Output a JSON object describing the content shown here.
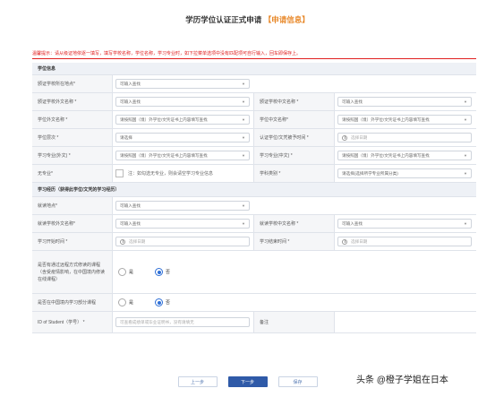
{
  "header": {
    "title": "学历学位认证正式申请",
    "tag": "【申请信息】"
  },
  "warning": "温馨提示：请从级证地依逐一填写，填写学校名称，学位名称，学习专业时，如下拉菜单选项中没有匹配项可自行输入，回车即保存上。",
  "sections": {
    "degree": "学位信息",
    "study": "学习经历（获得此学位/文凭的学习经历）"
  },
  "labels": {
    "issue_country": "颁证学校所在地点*",
    "school_en": "颁证学校外文名称 *",
    "school_cn": "颁证学校中文名称 *",
    "degree_en": "学位外文名称 *",
    "degree_cn": "学位中文名称*",
    "degree_level": "学位层次 *",
    "cert_date": "认证学位/文凭被予时间 *",
    "major_en": "学习专业(外文) *",
    "major_cn": "学习专业(中文) *",
    "no_major": "无专业*",
    "subject": "学科类别 *",
    "study_country": "就读地点*",
    "study_school_en": "就读学校外文名称*",
    "study_school_cn": "就读学校中文名称 *",
    "start": "学习开始时间 *",
    "end": "学习结束时间 *",
    "distance_q": "是否有通过远程方式修读的课程（含受疫情影响，在中国境内修读在线课程）",
    "china_q": "是否在中国境内学习部分课程",
    "student_id": "ID of Student（学号） *",
    "remark": "备注"
  },
  "fields": {
    "issue_country": "可输入查找",
    "school_en": "可输入查找",
    "school_cn": "可输入查找",
    "degree_en": "请按照国（境）外学位/文凭证书上内容填写查找",
    "degree_cn": "请按照国（境）外学位/文凭证书上内容填写查找",
    "degree_level": "请选择",
    "cert_date": "选择日期",
    "major_en": "请按照国（境）外学位/文凭证书上内容填写查找",
    "major_cn": "请按照国（境）外学位/文凭证书上内容填写查找",
    "no_major_text": "注：如勾选无专业，则会请空学习专业信息",
    "subject": "请选择(选择所学专业所属分类)",
    "study_country": "可输入查找",
    "study_school_en": "可输入查找",
    "study_school_cn": "可输入查找",
    "start": "选择日期",
    "end": "选择日期",
    "student_id": "可查看成绩单或毕业证明书，没有请填无"
  },
  "radio": {
    "yes": "是",
    "no": "否"
  },
  "buttons": {
    "prev": "上一步",
    "next": "下一步",
    "save": "保存"
  },
  "watermark": "头条 @橙子学姐在日本"
}
